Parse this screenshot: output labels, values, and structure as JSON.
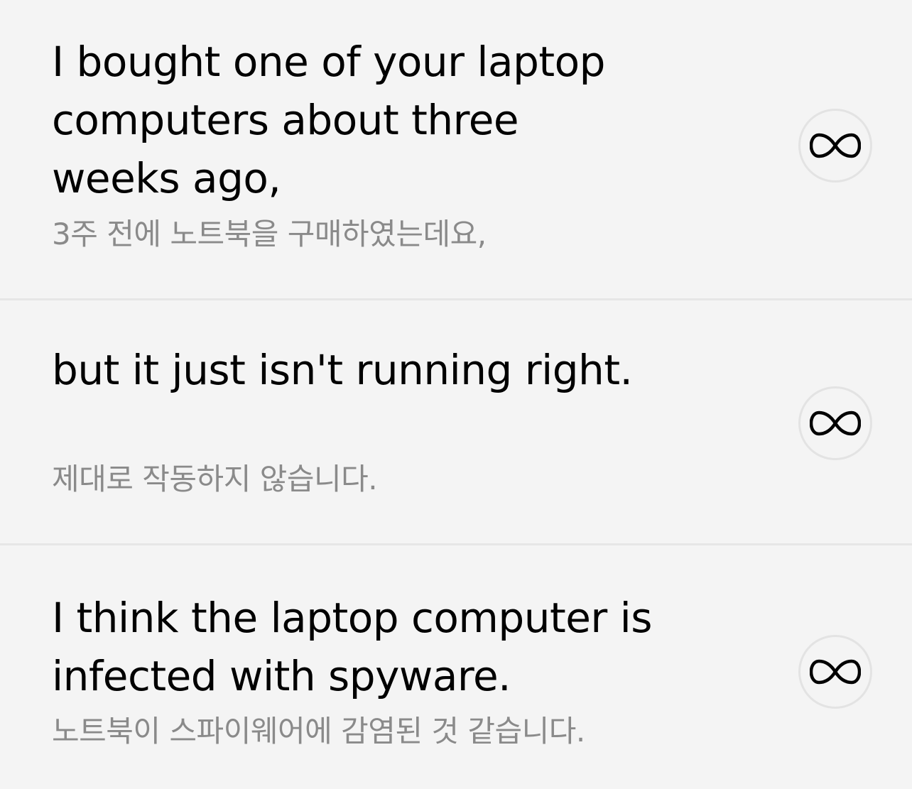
{
  "sentences": [
    {
      "english": "I bought one of your laptop\ncomputers about three\nweeks ago,",
      "korean": "3주 전에 노트북을 구매하였는데요,",
      "action_icon": "infinity-loop-icon"
    },
    {
      "english": "but it just isn't running right.",
      "korean": "제대로 작동하지 않습니다.",
      "action_icon": "infinity-loop-icon"
    },
    {
      "english": "I think the laptop computer is\ninfected with spyware.",
      "korean": "노트북이 스파이웨어에 감염된 것 같습니다.",
      "action_icon": "infinity-loop-icon"
    }
  ],
  "colors": {
    "background": "#f4f4f4",
    "english_text": "#000000",
    "korean_text": "#8a8a8a",
    "divider": "#e6e6e6",
    "button_border": "#e3e3e3"
  }
}
